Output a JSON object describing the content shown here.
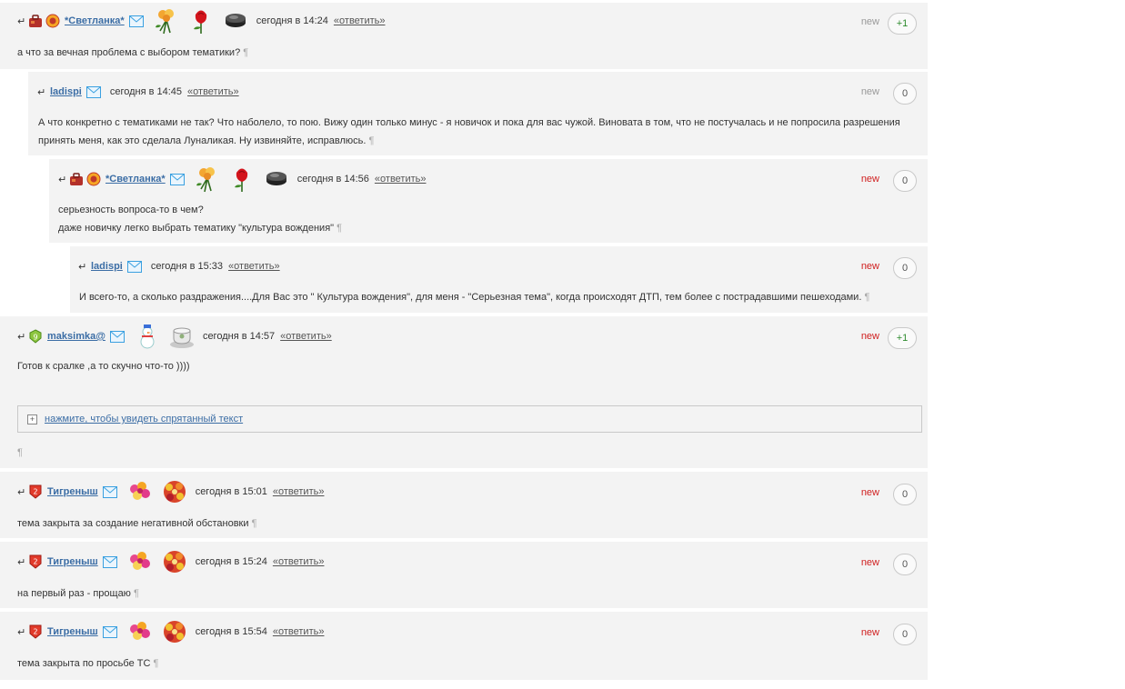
{
  "reply_label": "«ответить»",
  "pilcrow": "¶",
  "comments": [
    {
      "user": "*Светланка*",
      "time": "сегодня в 14:24",
      "new_flag": "new",
      "new_style": "gray",
      "score": "+1",
      "text": [
        "а что за вечная проблема с выбором тематики?"
      ]
    },
    {
      "user": "ladispi",
      "time": "сегодня в 14:45",
      "new_flag": "new",
      "new_style": "gray",
      "score": "0",
      "text": [
        "А что конкретно с тематиками не так? Что наболело, то пою. Вижу один только минус - я новичок и пока для вас чужой. Виновата в том, что не постучалась и не попросила разрешения",
        "принять меня, как это сделала Луналикая. Ну извиняйте, исправлюсь."
      ]
    },
    {
      "user": "*Светланка*",
      "time": "сегодня в 14:56",
      "new_flag": "new",
      "new_style": "red",
      "score": "0",
      "text": [
        "серьезность вопроса-то в чем?",
        "даже новичку легко выбрать тематику \"культура вождения\""
      ]
    },
    {
      "user": "ladispi",
      "time": "сегодня в 15:33",
      "new_flag": "new",
      "new_style": "red",
      "score": "0",
      "text": [
        "И всего-то, а сколько раздражения....Для Вас это \" Культура вождения\", для меня - \"Серьезная тема\", когда происходят ДТП, тем более с пострадавшими пешеходами."
      ]
    },
    {
      "user": "maksimka@",
      "time": "сегодня в 14:57",
      "new_flag": "new",
      "new_style": "red",
      "score": "+1",
      "text": [
        "Готов к сралке ,а то скучно что-то ))))"
      ],
      "spoiler": "нажмите, чтобы увидеть спрятанный текст"
    },
    {
      "user": "Тигреныш",
      "time": "сегодня в 15:01",
      "new_flag": "new",
      "new_style": "red",
      "score": "0",
      "text": [
        "тема закрыта за создание негативной обстановки"
      ]
    },
    {
      "user": "Тигреныш",
      "time": "сегодня в 15:24",
      "new_flag": "new",
      "new_style": "red",
      "score": "0",
      "text": [
        "на первый раз - прощаю"
      ]
    },
    {
      "user": "Тигреныш",
      "time": "сегодня в 15:54",
      "new_flag": "new",
      "new_style": "red",
      "score": "0",
      "text": [
        "тема закрыта по просьбе ТС"
      ]
    }
  ],
  "colors": {
    "link": "#3b6da5",
    "new_red": "#d01f1f",
    "new_gray": "#999999",
    "score_positive": "#2d8b2d",
    "comment_bg": "#f3f3f3"
  },
  "icons": {
    "thread_arrow": "reply-arrow-icon",
    "mail": "envelope-icon",
    "gifts_svetlanka": [
      "rose-bouquet-icon",
      "red-rose-icon",
      "hockey-puck-icon"
    ],
    "gifts_maksimka": [
      "snowman-icon",
      "teacup-icon"
    ],
    "gifts_tigrenysh": [
      "flower-bouquet-icon",
      "flower-basket-icon"
    ]
  }
}
